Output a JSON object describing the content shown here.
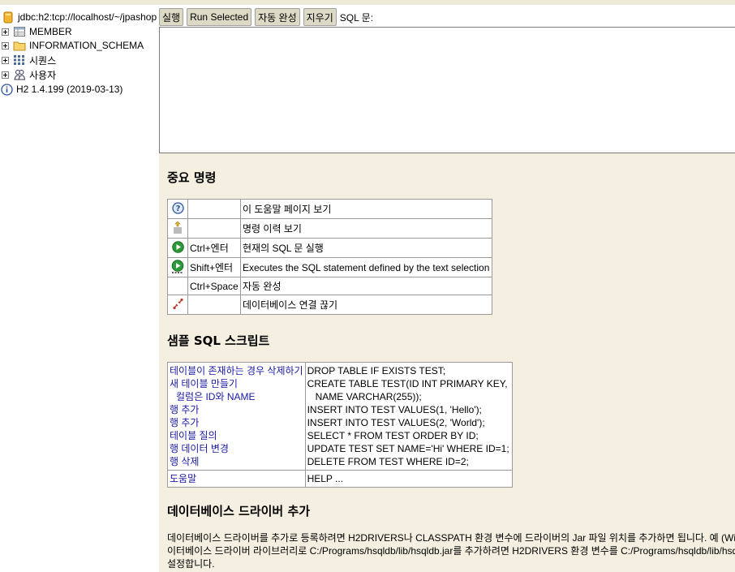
{
  "tree": {
    "connection": "jdbc:h2:tcp://localhost/~/jpashop",
    "items": [
      {
        "label": "MEMBER",
        "icon": "table-icon"
      },
      {
        "label": "INFORMATION_SCHEMA",
        "icon": "folder-icon"
      },
      {
        "label": "시퀀스",
        "icon": "sequence-icon"
      },
      {
        "label": "사용자",
        "icon": "users-icon"
      }
    ],
    "version": "H2 1.4.199 (2019-03-13)"
  },
  "toolbar": {
    "run": "실행",
    "run_selected": "Run Selected",
    "auto_complete": "자동 완성",
    "clear": "지우기",
    "sql_label": "SQL 문:"
  },
  "sql_input": "",
  "help": {
    "important_title": "중요 명령",
    "commands": [
      {
        "icon": "help-icon",
        "key": "",
        "desc": "이 도움말 페이지 보기"
      },
      {
        "icon": "history-icon",
        "key": "",
        "desc": "명령 이력 보기"
      },
      {
        "icon": "run-icon",
        "key": "Ctrl+엔터",
        "desc": "현재의 SQL 문 실행"
      },
      {
        "icon": "run-selected-icon",
        "key": "Shift+엔터",
        "desc": "Executes the SQL statement defined by the text selection"
      },
      {
        "icon": "",
        "key": "Ctrl+Space",
        "desc": "자동 완성"
      },
      {
        "icon": "disconnect-icon",
        "key": "",
        "desc": "데이터베이스 연결 끊기"
      }
    ],
    "sample_title": "샘플 SQL 스크립트",
    "sample_links": [
      "테이블이 존재하는 경우 삭제하기",
      "새 테이블 만들기",
      "컬럼은 ID와 NAME",
      "행 추가",
      "행 추가",
      "테이블 질의",
      "행 데이터 변경",
      "행 삭제"
    ],
    "sample_code": [
      "DROP TABLE IF EXISTS TEST;",
      "CREATE TABLE TEST(ID INT PRIMARY KEY,",
      "   NAME VARCHAR(255));",
      "INSERT INTO TEST VALUES(1, 'Hello');",
      "INSERT INTO TEST VALUES(2, 'World');",
      "SELECT * FROM TEST ORDER BY ID;",
      "UPDATE TEST SET NAME='Hi' WHERE ID=1;",
      "DELETE FROM TEST WHERE ID=2;"
    ],
    "help_link": "도움말",
    "help_code": "HELP ...",
    "driver_title": "데이터베이스 드라이버 추가",
    "driver_text_1": "데이터베이스 드라이버를 추가로 등록하려면 H2DRIVERS나 CLASSPATH 환경 변수에 드라이버의 Jar 파일 위치를 추가하면 됩니다. 예 (Window",
    "driver_text_2": "이터베이스 드라이버 라이브러리로 C:/Programs/hsqldb/lib/hsqldb.jar를 추가하려면 H2DRIVERS 환경 변수를 C:/Programs/hsqldb/lib/hsqldb",
    "driver_text_3": "설정합니다."
  }
}
